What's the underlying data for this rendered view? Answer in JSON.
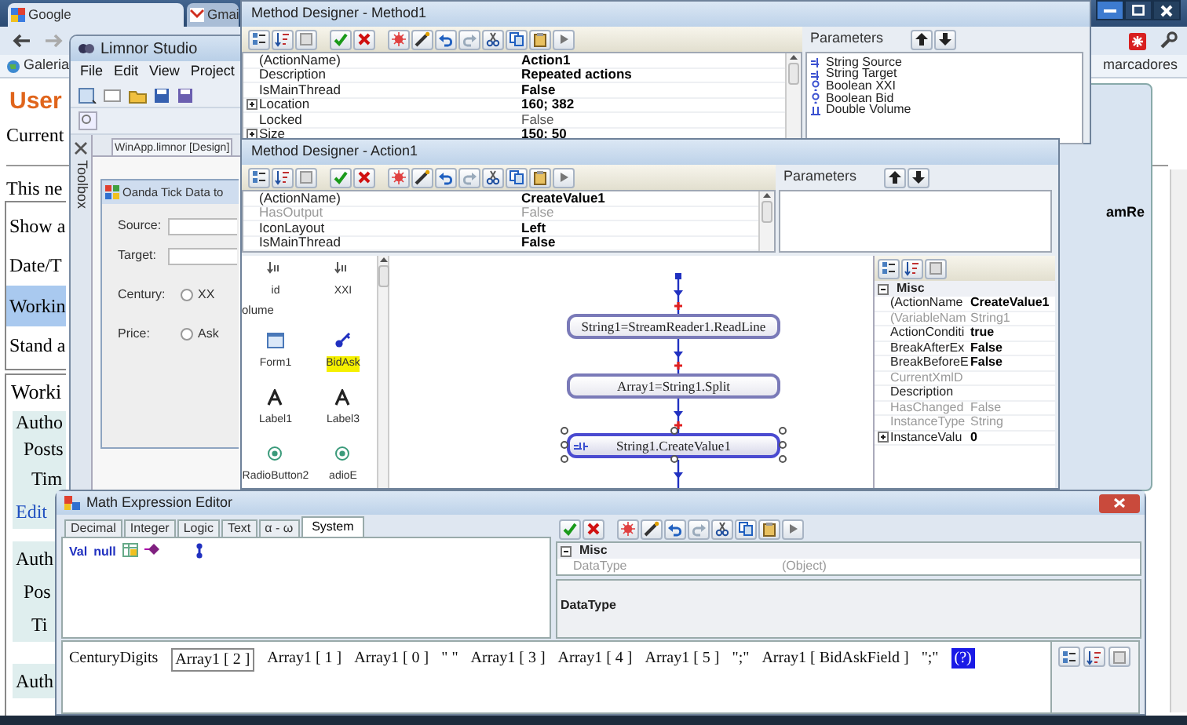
{
  "browser": {
    "tabs": [
      {
        "label": "Google",
        "selected": true
      },
      {
        "label": "Gmai",
        "selected": false
      }
    ],
    "bookmarks": [
      {
        "label": "Galeria"
      },
      {
        "label": "marcadores"
      }
    ],
    "page": {
      "heading": "User",
      "intro": [
        "Current",
        "This ne"
      ],
      "menu_rows": [
        {
          "label": "Show a",
          "selected": false
        },
        {
          "label": "Date/T",
          "selected": false
        },
        {
          "label": "Workin",
          "selected": true
        },
        {
          "label": "Stand a",
          "selected": false
        }
      ],
      "section_title": "Worki",
      "entries": [
        {
          "lines": [
            "Autho",
            "Posts",
            "Tim"
          ],
          "link": "Edit"
        },
        {
          "lines": [
            "Auth",
            "Pos",
            "Ti"
          ]
        },
        {
          "lines": [
            "Auth"
          ]
        }
      ]
    }
  },
  "limnor": {
    "title": "Limnor Studio",
    "menu": [
      "File",
      "Edit",
      "View",
      "Project"
    ],
    "toolbox_label": "Toolbox",
    "document_tab": "WinApp.limnor [Design]",
    "form": {
      "title": "Oanda Tick Data to",
      "fields": [
        {
          "label": "Source:"
        },
        {
          "label": "Target:"
        }
      ],
      "options": [
        {
          "label": "Century:",
          "choice": "XX",
          "checked": false
        },
        {
          "label": "Price:",
          "choice": "Ask",
          "checked": false
        }
      ]
    }
  },
  "method_designer": {
    "title": "Method Designer - Method1",
    "properties": [
      {
        "name": "(ActionName)",
        "value": "Action1",
        "modified": true,
        "disabled": false,
        "expandable": false
      },
      {
        "name": "Description",
        "value": "Repeated actions",
        "modified": true,
        "disabled": false,
        "expandable": false
      },
      {
        "name": "IsMainThread",
        "value": "False",
        "modified": true,
        "disabled": false,
        "expandable": false
      },
      {
        "name": "Location",
        "value": "160; 382",
        "modified": true,
        "disabled": false,
        "expandable": true
      },
      {
        "name": "Locked",
        "value": "False",
        "modified": false,
        "disabled": false,
        "expandable": false
      },
      {
        "name": "Size",
        "value": "150; 50",
        "modified": true,
        "disabled": false,
        "expandable": true
      }
    ],
    "parameters": {
      "title": "Parameters",
      "items": [
        {
          "kind": "string",
          "label": "String Source"
        },
        {
          "kind": "string",
          "label": "String Target"
        },
        {
          "kind": "boolean",
          "label": "Boolean XXI"
        },
        {
          "kind": "boolean",
          "label": "Boolean Bid"
        },
        {
          "kind": "double",
          "label": "Double Volume"
        }
      ]
    }
  },
  "action_designer": {
    "title": "Method Designer - Action1",
    "properties": [
      {
        "name": "(ActionName)",
        "value": "CreateValue1",
        "modified": true,
        "disabled": false,
        "expandable": false
      },
      {
        "name": "HasOutput",
        "value": "False",
        "modified": false,
        "disabled": true,
        "expandable": false
      },
      {
        "name": "IconLayout",
        "value": "Left",
        "modified": true,
        "disabled": false,
        "expandable": false
      },
      {
        "name": "IsMainThread",
        "value": "False",
        "modified": true,
        "disabled": false,
        "expandable": false
      }
    ],
    "parameters": {
      "title": "Parameters"
    },
    "toolbox": [
      {
        "kind": "variable",
        "label": "id",
        "selected": false
      },
      {
        "kind": "variable",
        "label": "XXI",
        "selected": false
      },
      {
        "kind": "fragment",
        "label": "olume",
        "selected": false
      },
      {
        "kind": "form",
        "label": "Form1",
        "selected": false
      },
      {
        "kind": "key",
        "label": "BidAsk",
        "selected": true
      },
      {
        "kind": "label",
        "label": "Label1",
        "selected": false
      },
      {
        "kind": "label",
        "label": "Label3",
        "selected": false
      },
      {
        "kind": "radio",
        "label": "RadioButton2",
        "selected": false
      },
      {
        "kind": "radio",
        "label": "adioE",
        "selected": false
      }
    ],
    "flow": [
      {
        "kind": "action",
        "text": "String1=StreamReader1.ReadLine",
        "selected": false
      },
      {
        "kind": "action",
        "text": "Array1=String1.Split",
        "selected": false
      },
      {
        "kind": "value",
        "text": "String1.CreateValue1",
        "selected": true
      }
    ],
    "side_properties": {
      "category": "Misc",
      "rows": [
        {
          "name": "(ActionName",
          "value": "CreateValue1",
          "modified": true,
          "disabled": false,
          "expandable": false
        },
        {
          "name": "(VariableNam",
          "value": "String1",
          "modified": false,
          "disabled": true,
          "expandable": false
        },
        {
          "name": "ActionConditi",
          "value": "true",
          "modified": true,
          "disabled": false,
          "expandable": false
        },
        {
          "name": "BreakAfterEx",
          "value": "False",
          "modified": true,
          "disabled": false,
          "expandable": false
        },
        {
          "name": "BreakBeforeE",
          "value": "False",
          "modified": true,
          "disabled": false,
          "expandable": false
        },
        {
          "name": "CurrentXmlD",
          "disabled": true,
          "expandable": false
        },
        {
          "name": "Description",
          "disabled": false,
          "expandable": false
        },
        {
          "name": "HasChanged",
          "value": "False",
          "modified": false,
          "disabled": true,
          "expandable": false
        },
        {
          "name": "InstanceType",
          "value": "String",
          "modified": false,
          "disabled": true,
          "expandable": false
        },
        {
          "name": "InstanceValu",
          "value": "0",
          "modified": true,
          "disabled": false,
          "expandable": true
        }
      ]
    }
  },
  "background_window": {
    "text": "amRe"
  },
  "math_editor": {
    "title": "Math Expression Editor",
    "tabs": [
      {
        "label": "Decimal",
        "selected": false
      },
      {
        "label": "Integer",
        "selected": false
      },
      {
        "label": "Logic",
        "selected": false
      },
      {
        "label": "Text",
        "selected": false
      },
      {
        "label": "α - ω",
        "selected": false
      },
      {
        "label": "System",
        "selected": true
      }
    ],
    "palette": [
      "Val",
      "null"
    ],
    "properties": {
      "category": "Misc",
      "rows": [
        {
          "name": "DataType",
          "value": "(Object)",
          "modified": false,
          "disabled": true,
          "expandable": false
        }
      ]
    },
    "description": "DataType",
    "expression": [
      {
        "kind": "plain",
        "text": "CenturyDigits"
      },
      {
        "kind": "boxed",
        "text": "Array1 [ 2 ]"
      },
      {
        "kind": "plain",
        "text": "Array1 [ 1 ]"
      },
      {
        "kind": "plain",
        "text": "Array1 [ 0 ]"
      },
      {
        "kind": "plain",
        "text": "\" \""
      },
      {
        "kind": "plain",
        "text": "Array1 [ 3 ]"
      },
      {
        "kind": "plain",
        "text": "Array1 [ 4 ]"
      },
      {
        "kind": "plain",
        "text": "Array1 [ 5 ]"
      },
      {
        "kind": "plain",
        "text": "\";\""
      },
      {
        "kind": "plain",
        "text": "Array1 [ BidAskField ]"
      },
      {
        "kind": "plain",
        "text": "\";\""
      },
      {
        "kind": "selected",
        "text": "(?)"
      }
    ]
  }
}
